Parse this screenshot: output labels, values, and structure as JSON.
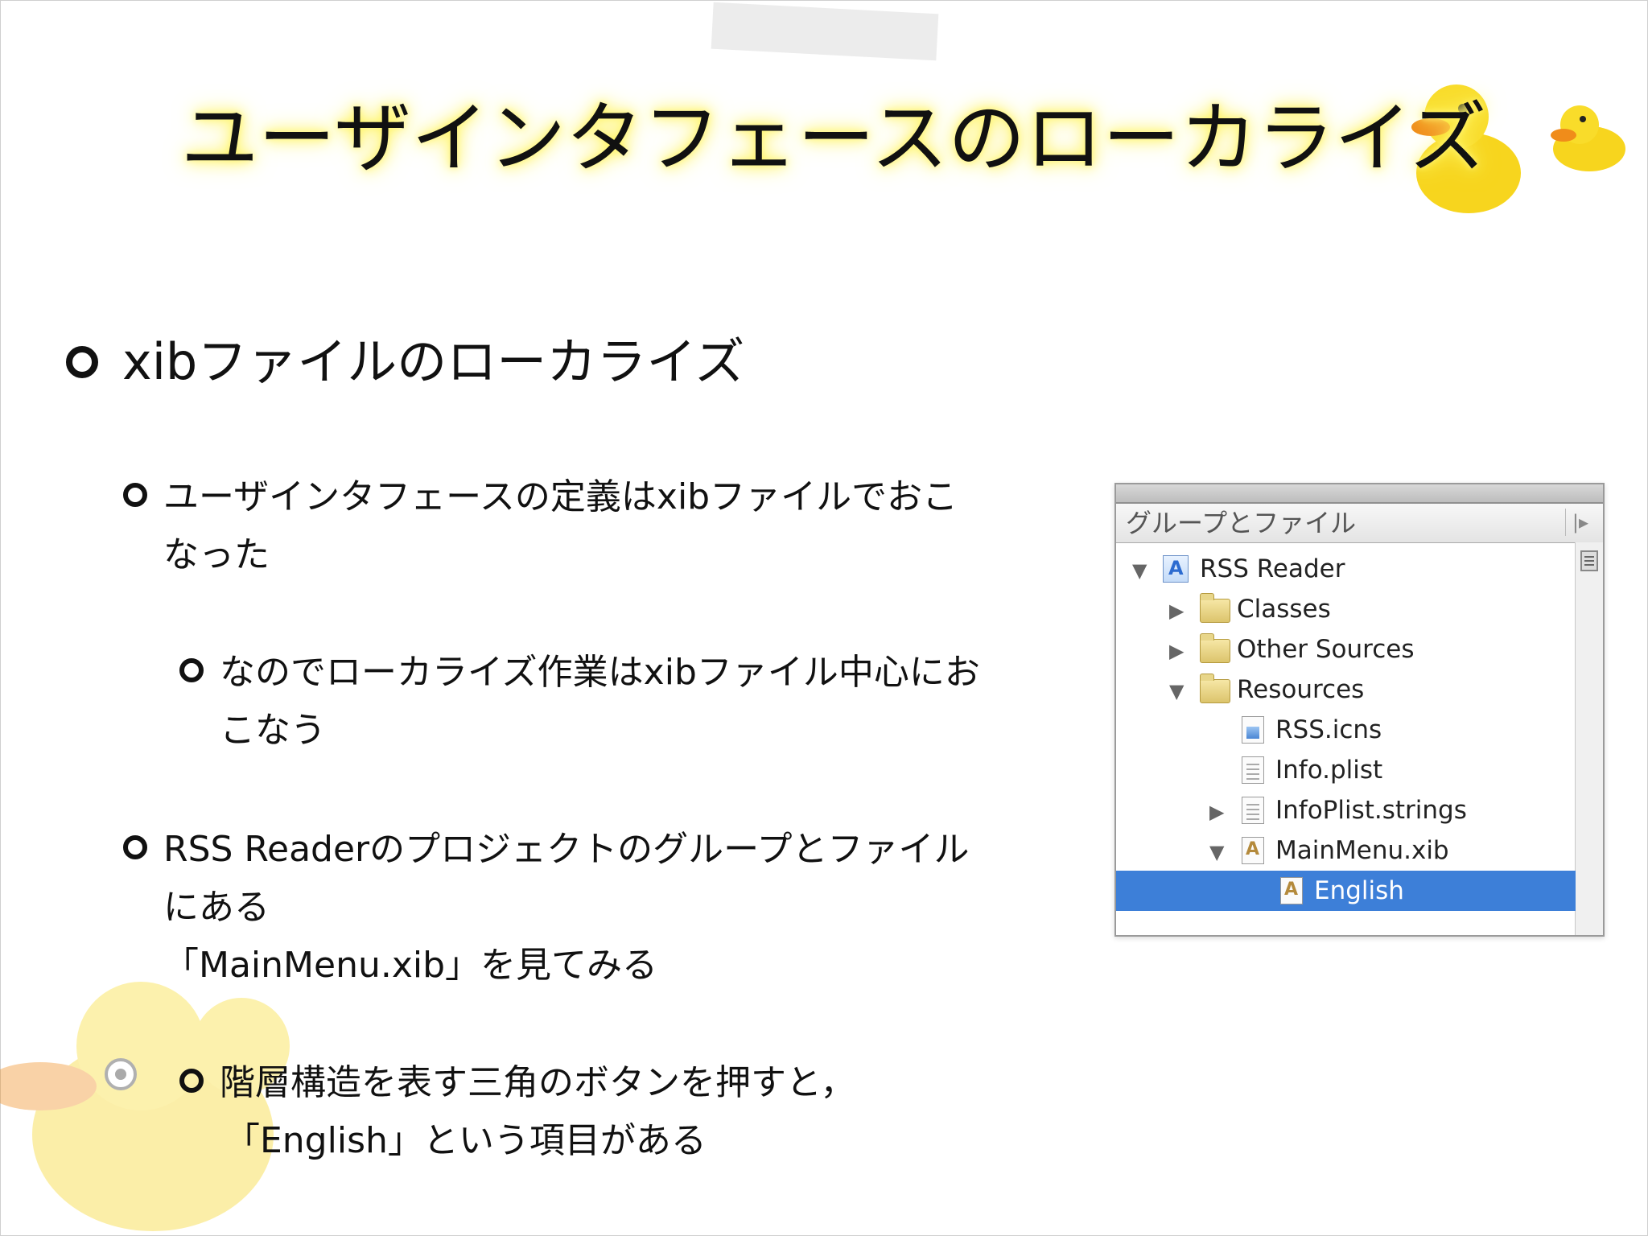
{
  "slide": {
    "title": "ユーザインタフェースのローカライズ",
    "bullets": {
      "l1": "xibファイルのローカライズ",
      "item1": "ユーザインタフェースの定義はxibファイルでおこなった",
      "item2": "なのでローカライズ作業はxibファイル中心におこなう",
      "item3_line1": "RSS Readerのプロジェクトのグループとファイルにある",
      "item3_line2": "「MainMenu.xib」を見てみる",
      "item4_line1": "階層構造を表す三角のボタンを押すと，",
      "item4_line2": "「English」という項目がある"
    }
  },
  "xcode_panel": {
    "header": "グループとファイル",
    "tree": [
      {
        "label": "RSS Reader",
        "icon": "project-icon",
        "expanded": true
      },
      {
        "label": "Classes",
        "icon": "folder-icon",
        "expanded": false
      },
      {
        "label": "Other Sources",
        "icon": "folder-icon",
        "expanded": false
      },
      {
        "label": "Resources",
        "icon": "folder-icon",
        "expanded": true
      },
      {
        "label": "RSS.icns",
        "icon": "icns-file-icon"
      },
      {
        "label": "Info.plist",
        "icon": "plist-file-icon"
      },
      {
        "label": "InfoPlist.strings",
        "icon": "strings-file-icon",
        "expanded": false
      },
      {
        "label": "MainMenu.xib",
        "icon": "xib-file-icon",
        "expanded": true
      },
      {
        "label": "English",
        "icon": "xib-file-icon",
        "selected": true
      }
    ],
    "selected_color": "#3d7fd8"
  }
}
